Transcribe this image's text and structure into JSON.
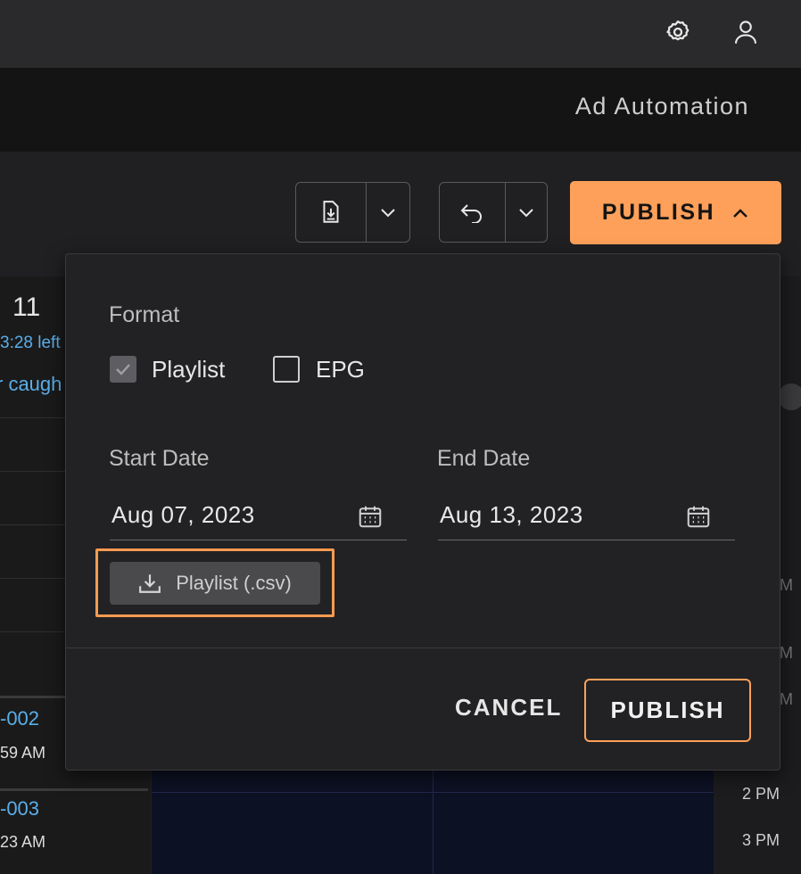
{
  "header": {
    "section_title": "Ad Automation"
  },
  "toolbar": {
    "publish_label": "PUBLISH"
  },
  "background": {
    "day_number": "11",
    "time_left": "3:28 left",
    "caught_text": "r caugh",
    "items": [
      {
        "id": "-002",
        "time": "59 AM"
      },
      {
        "id": "-003",
        "time": "23 AM"
      }
    ],
    "time_labels": [
      "M",
      "M",
      "M",
      "2 PM",
      "3 PM"
    ]
  },
  "dialog": {
    "format_label": "Format",
    "formats": [
      {
        "label": "Playlist",
        "checked": true,
        "disabled": true
      },
      {
        "label": "EPG",
        "checked": false
      }
    ],
    "start_date_label": "Start Date",
    "start_date_value": "Aug 07, 2023",
    "end_date_label": "End Date",
    "end_date_value": "Aug 13, 2023",
    "download_label": "Playlist (.csv)",
    "cancel_label": "CANCEL",
    "publish_label": "PUBLISH"
  },
  "colors": {
    "accent": "#ffa05a",
    "link": "#5aaeea",
    "highlight": "#ff9b50"
  }
}
